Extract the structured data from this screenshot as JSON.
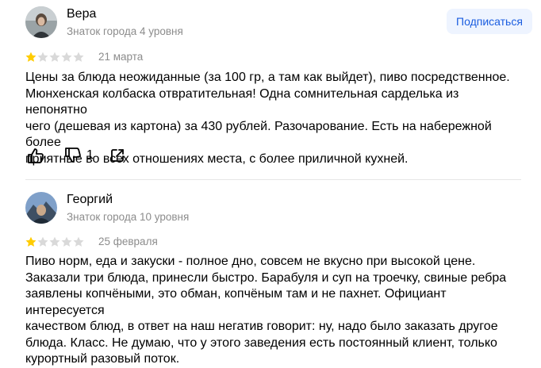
{
  "subscribe_label": "Подписаться",
  "colors": {
    "star_filled": "#fc0",
    "star_empty": "#d9d9d9",
    "accent": "#1a5de0",
    "muted": "#8c8c8c"
  },
  "reviews": [
    {
      "author": "Вера",
      "level": "Знаток города 4 уровня",
      "rating": 1,
      "max_rating": 5,
      "date": "21 марта",
      "lines": [
        "Цены за блюда неожиданные (за 100 гр, а там как выйдет), пиво посредственное.",
        "Мюнхенская колбаска отвратительная! Одна сомнительная сарделька из непонятно",
        "чего (дешевая из картона) за 430 рублей. Разочарование. Есть на набережной более",
        "приятные во всех отношениях места, с более приличной кухней."
      ],
      "dislikes": "1",
      "icons": {
        "like": "thumbs-up-icon",
        "dislike": "thumbs-down-icon",
        "share": "share-icon"
      }
    },
    {
      "author": "Георгий",
      "level": "Знаток города 10 уровня",
      "rating": 1,
      "max_rating": 5,
      "date": "25 февраля",
      "lines": [
        "Пиво норм, еда и закуски - полное дно, совсем не вкусно при высокой цене.",
        "Заказали три блюда, принесли быстро. Барабуля и суп на троечку, свиные ребра",
        "заявлены копчёными, это обман, копчёным там и не пахнет. Официант интересуется",
        "качеством блюд, в ответ на наш негатив говорит: ну, надо было заказать другое",
        "блюда. Класс. Не думаю, что у этого заведения есть постоянный клиент, только",
        "курортный разовый поток."
      ]
    }
  ]
}
